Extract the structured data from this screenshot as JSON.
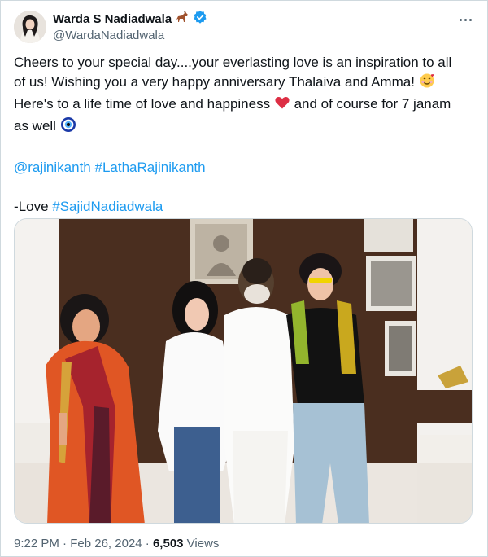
{
  "author": {
    "display_name": "Warda S Nadiadwala",
    "handle": "@WardaNadiadwala",
    "name_emoji": "horse-emoji",
    "verified": true
  },
  "tweet": {
    "lines": [
      "Cheers to your special day....your everlasting love is an inspiration to all",
      "of us! Wishing you a very happy anniversary Thalaiva and Amma!",
      "Here's to a life time of love and happiness",
      "and of course for 7 janam",
      "as well"
    ],
    "mentions": [
      "@rajinikanth",
      "#LathaRajinikanth"
    ],
    "signoff_prefix": "-Love ",
    "signoff_tag": "#SajidNadiadwala",
    "emojis": [
      "smiling-face-with-hearts-emoji",
      "red-heart-emoji",
      "nazar-amulet-emoji"
    ]
  },
  "footer": {
    "time": "9:22 PM",
    "sep1": " · ",
    "date": "Feb 26, 2024",
    "sep2": " · ",
    "views_count": "6,503",
    "views_label": " Views"
  },
  "colors": {
    "link": "#1d9bf0",
    "text": "#0f1419",
    "muted": "#536471",
    "verified": "#1d9bf0",
    "border": "#cfd9de"
  }
}
